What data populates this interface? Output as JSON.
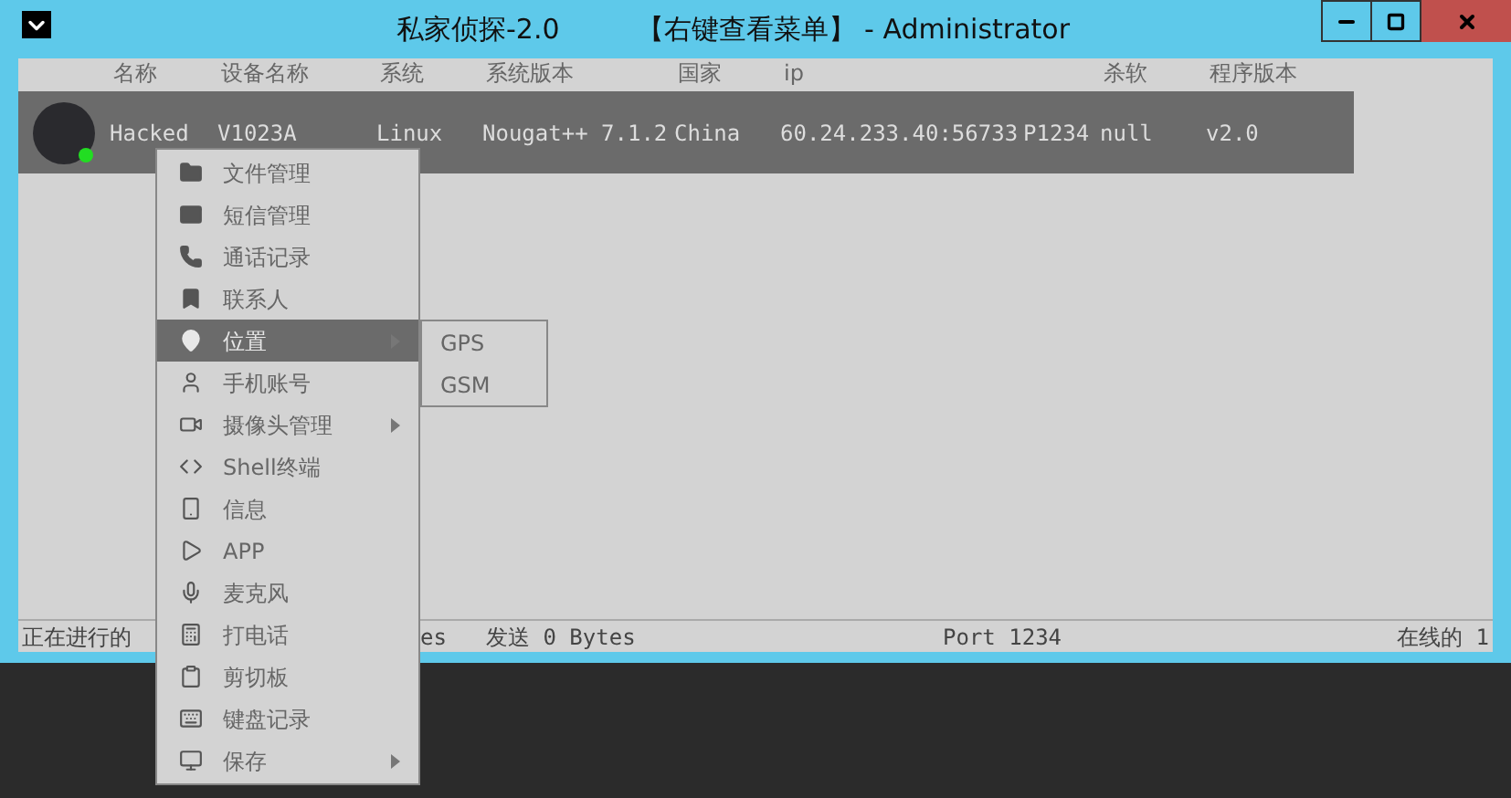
{
  "window": {
    "title": "私家侦探-2.0",
    "subtitle": "【右键查看菜单】 - Administrator"
  },
  "table": {
    "columns": [
      {
        "label": "名称"
      },
      {
        "label": "设备名称"
      },
      {
        "label": "系统"
      },
      {
        "label": "系统版本"
      },
      {
        "label": "国家"
      },
      {
        "label": "ip"
      },
      {},
      {
        "label": "杀软"
      },
      {
        "label": "程序版本"
      }
    ],
    "rows": [
      {
        "selected": true,
        "online": true,
        "cells": [
          "Hacked",
          "V1023A",
          "Linux",
          "Nougat++ 7.1.2",
          "China",
          "60.24.233.40:56733",
          "P1234",
          "null",
          "v2.0"
        ]
      }
    ]
  },
  "context_menu": {
    "items": [
      {
        "label": "文件管理",
        "selected": false,
        "submenu": false
      },
      {
        "label": "短信管理",
        "selected": false,
        "submenu": false
      },
      {
        "label": "通话记录",
        "selected": false,
        "submenu": false
      },
      {
        "label": "联系人",
        "selected": false,
        "submenu": false
      },
      {
        "label": "位置",
        "selected": true,
        "submenu": true,
        "children": [
          {
            "label": "GPS"
          },
          {
            "label": "GSM"
          }
        ]
      },
      {
        "label": "手机账号",
        "selected": false,
        "submenu": false
      },
      {
        "label": "摄像头管理",
        "selected": false,
        "submenu": true
      },
      {
        "label": "Shell终端",
        "selected": false,
        "submenu": false
      },
      {
        "label": "信息",
        "selected": false,
        "submenu": false
      },
      {
        "label": "APP",
        "selected": false,
        "submenu": false
      },
      {
        "label": "麦克风",
        "selected": false,
        "submenu": false
      },
      {
        "label": "打电话",
        "selected": false,
        "submenu": false
      },
      {
        "label": "剪切板",
        "selected": false,
        "submenu": false
      },
      {
        "label": "键盘记录",
        "selected": false,
        "submenu": false
      },
      {
        "label": "保存",
        "selected": false,
        "submenu": true
      }
    ]
  },
  "status_bar": {
    "left": "正在进行的",
    "left_tail": "es",
    "sent": "发送 0 Bytes",
    "port": "Port 1234",
    "online": "在线的 1"
  }
}
